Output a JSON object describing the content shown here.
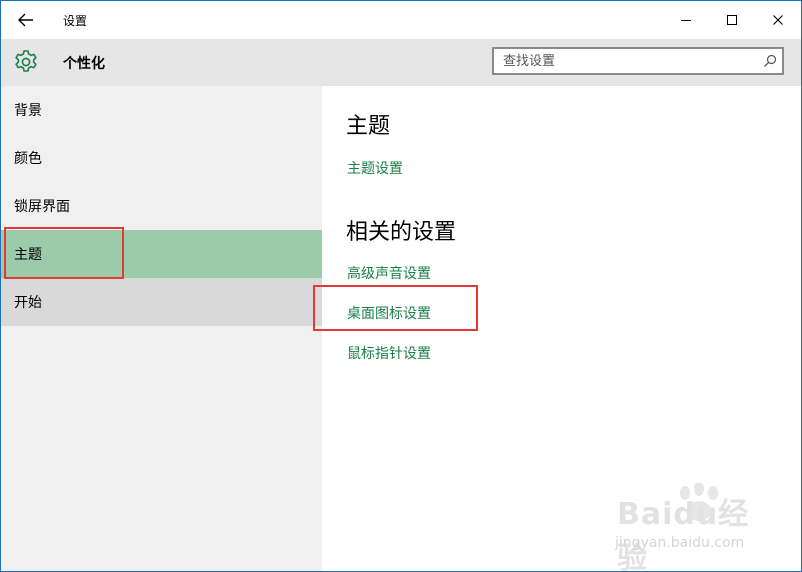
{
  "window": {
    "title": "设置",
    "controls": {
      "minimize": "—",
      "maximize": "☐",
      "close": "✕"
    }
  },
  "header": {
    "title": "个性化",
    "search": {
      "placeholder": "查找设置"
    }
  },
  "sidebar": {
    "items": [
      {
        "label": "背景"
      },
      {
        "label": "颜色"
      },
      {
        "label": "锁屏界面"
      },
      {
        "label": "主题",
        "selected": true
      },
      {
        "label": "开始"
      }
    ]
  },
  "main": {
    "section1": {
      "title": "主题",
      "links": [
        "主题设置"
      ]
    },
    "section2": {
      "title": "相关的设置",
      "links": [
        "高级声音设置",
        "桌面图标设置",
        "鼠标指针设置"
      ]
    }
  },
  "watermark": {
    "logo": "Baidu经验",
    "url": "jingyan.baidu.com"
  },
  "colors": {
    "accent_green": "#1a7f49",
    "selected_bg": "#9ccbac",
    "highlight_red": "#e53935",
    "sidebar_bg": "#f0f0f0",
    "header_bg": "#e6e6e6"
  },
  "icons": [
    "back-arrow-icon",
    "gear-icon",
    "search-icon",
    "minimize-icon",
    "maximize-icon",
    "close-icon"
  ]
}
